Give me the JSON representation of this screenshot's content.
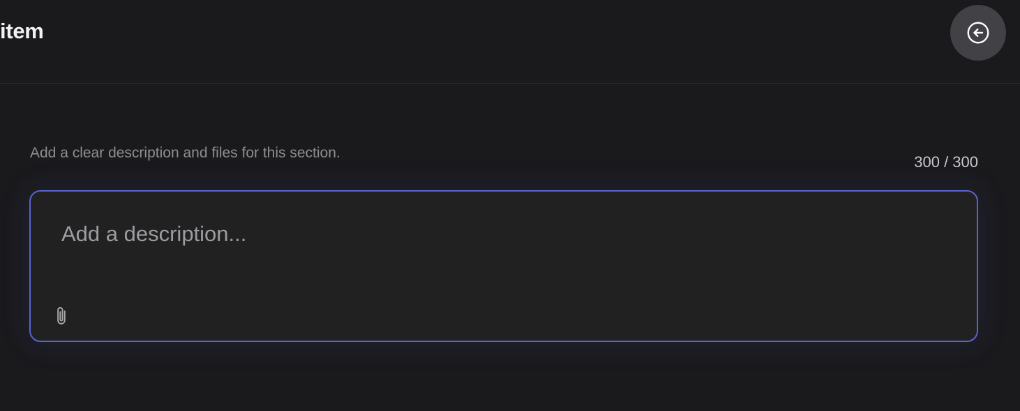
{
  "header": {
    "title": "item",
    "back_button_icon": "arrow-left-circle-icon"
  },
  "section": {
    "hint": "Add a clear description and files for this section.",
    "char_count": "300 / 300"
  },
  "editor": {
    "placeholder": "Add a description...",
    "value": "",
    "attach_icon": "paperclip-icon"
  },
  "colors": {
    "background": "#1a1a1d",
    "editor_border": "#5b63d3",
    "editor_background": "#212121",
    "back_button": "#414146"
  }
}
